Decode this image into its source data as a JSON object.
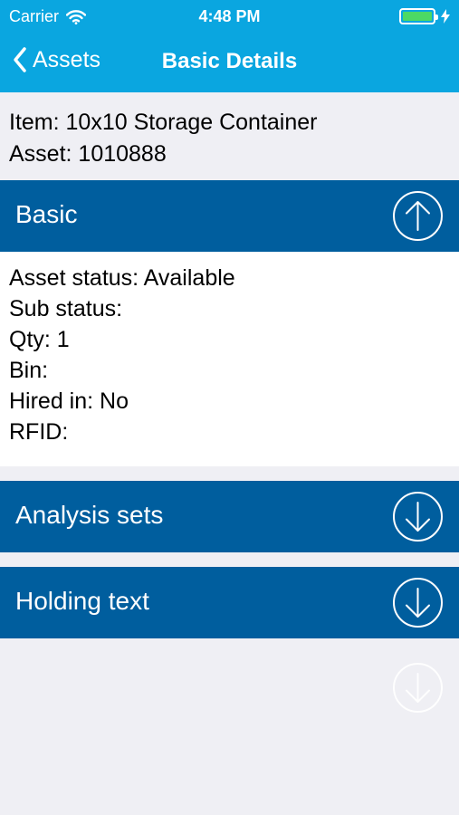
{
  "status_bar": {
    "carrier": "Carrier",
    "time": "4:48 PM",
    "battery_level": 1.0,
    "battery_color": "#4cd964",
    "icons": [
      "wifi-icon",
      "battery-icon",
      "charging-bolt-icon"
    ]
  },
  "nav": {
    "back_label": "Assets",
    "title": "Basic Details",
    "bar_color": "#0aa6e0"
  },
  "item": {
    "item_line": "Item: 10x10 Storage Container",
    "asset_line": "Asset: 1010888"
  },
  "sections": {
    "basic": {
      "label": "Basic",
      "expanded": true,
      "icon": "arrow-up-circle-icon",
      "fields": [
        "Asset status: Available",
        "Sub status:",
        "Qty: 1",
        "Bin:",
        "Hired in: No",
        "RFID:"
      ]
    },
    "analysis_sets": {
      "label": "Analysis sets",
      "expanded": false,
      "icon": "arrow-down-circle-icon"
    },
    "holding_text": {
      "label": "Holding text",
      "expanded": false,
      "icon": "arrow-down-circle-icon"
    }
  },
  "colors": {
    "section_header": "#005e9e",
    "background": "#efeff4"
  }
}
